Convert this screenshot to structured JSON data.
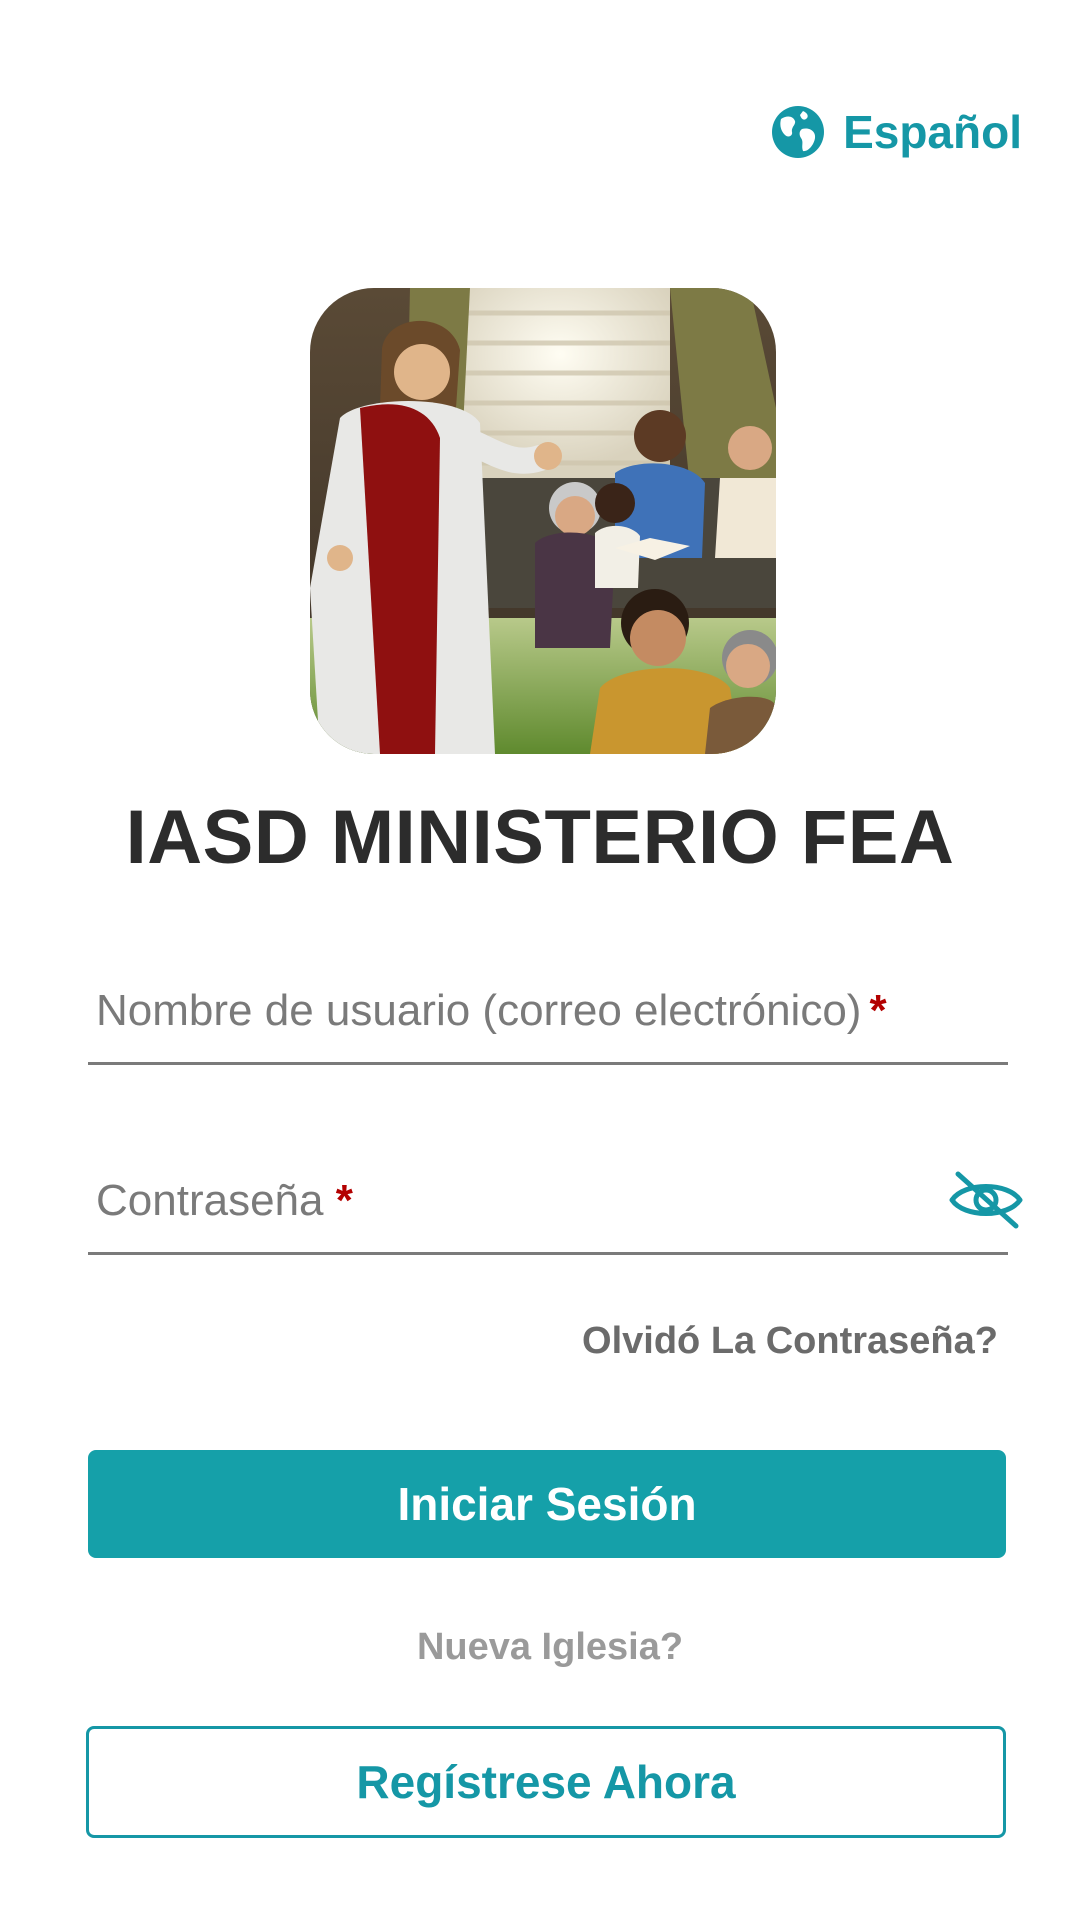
{
  "language": {
    "label": "Español",
    "icon": "globe-icon"
  },
  "app": {
    "title": "IASD MINISTERIO FEA"
  },
  "login_form": {
    "username": {
      "label": "Nombre de usuario (correo electrónico)",
      "required_mark": "*",
      "value": ""
    },
    "password": {
      "label": "Contraseña ",
      "required_mark": "*",
      "value": "",
      "visibility_icon": "eye-off-icon"
    },
    "forgot_password": "Olvidó La Contraseña?",
    "submit": "Iniciar Sesión"
  },
  "register": {
    "prompt": "Nueva Iglesia?",
    "button": "Regístrese Ahora"
  },
  "colors": {
    "accent": "#15a0a9",
    "accent_text": "#1597a6",
    "title": "#2c2c2c",
    "muted": "#7a7a7a",
    "required": "#b30000"
  }
}
